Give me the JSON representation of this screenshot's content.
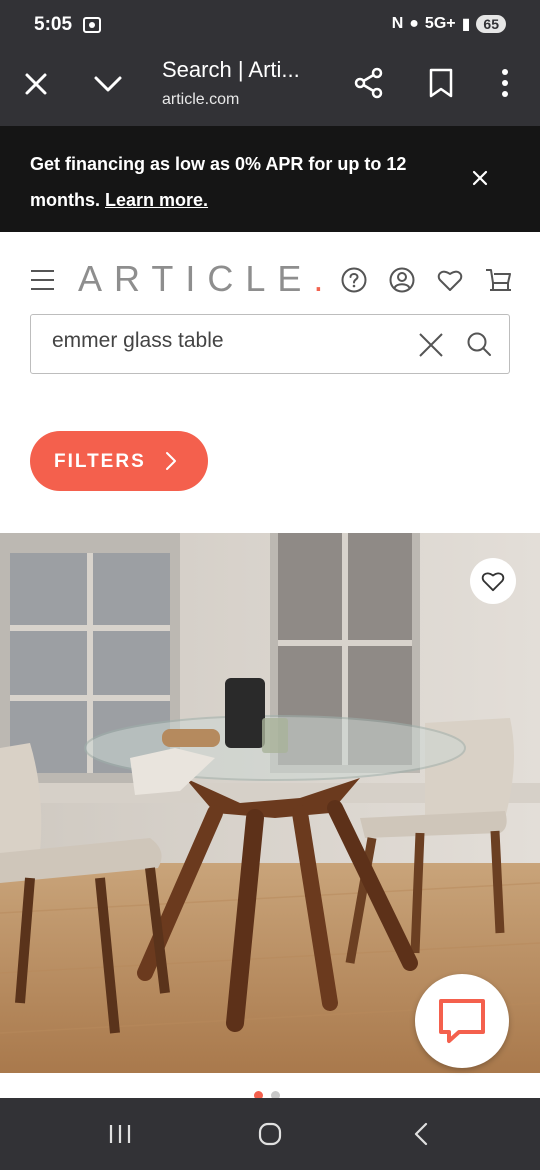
{
  "status_bar": {
    "time": "5:05",
    "network": "5G+",
    "battery": "65"
  },
  "browser": {
    "title": "Search | Arti...",
    "domain": "article.com"
  },
  "promo": {
    "text": "Get financing as low as 0% APR for up to 12 months.",
    "link": "Learn more."
  },
  "header": {
    "logo": "ARTICLE",
    "logo_dot": "."
  },
  "search": {
    "value": "emmer glass table"
  },
  "filters": {
    "label": "FILTERS"
  },
  "colors": {
    "accent": "#f4604d",
    "dark_bar": "#323236",
    "promo_bg": "#151515"
  },
  "product": {
    "image": "round glass dining table with walnut base and two chairs",
    "carousel_index": 1,
    "carousel_count": 2
  }
}
